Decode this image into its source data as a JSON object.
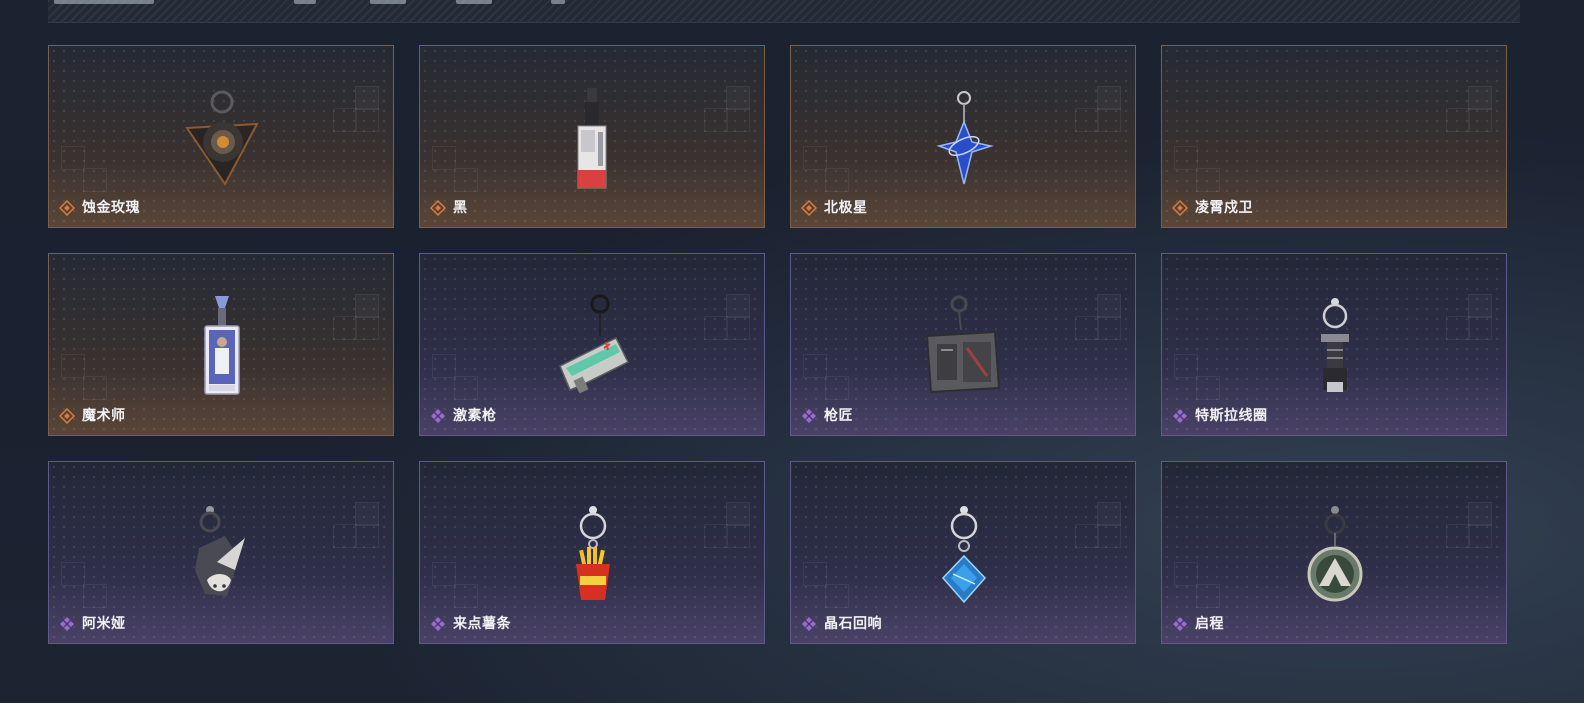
{
  "page": {
    "title": ""
  },
  "rarity_colors": {
    "gold": "#e07a3a",
    "purple": "#9a6ad6"
  },
  "cards": [
    {
      "name": "蚀金玫瑰",
      "rarity": "gold",
      "icon": "charm-corroded-rose-icon"
    },
    {
      "name": "黑",
      "rarity": "gold",
      "icon": "charm-black-tag-icon"
    },
    {
      "name": "北极星",
      "rarity": "gold",
      "icon": "charm-polaris-star-icon"
    },
    {
      "name": "凌霄戍卫",
      "rarity": "gold",
      "icon": ""
    },
    {
      "name": "魔术师",
      "rarity": "gold",
      "icon": "charm-magician-card-icon"
    },
    {
      "name": "激素枪",
      "rarity": "purple",
      "icon": "charm-stim-gun-icon"
    },
    {
      "name": "枪匠",
      "rarity": "purple",
      "icon": "charm-gunsmith-case-icon"
    },
    {
      "name": "特斯拉线圈",
      "rarity": "purple",
      "icon": "charm-tesla-coil-icon"
    },
    {
      "name": "阿米娅",
      "rarity": "purple",
      "icon": "charm-amiya-bunny-icon"
    },
    {
      "name": "来点薯条",
      "rarity": "purple",
      "icon": "charm-fries-icon"
    },
    {
      "name": "晶石回响",
      "rarity": "purple",
      "icon": "charm-crystal-echo-icon"
    },
    {
      "name": "启程",
      "rarity": "purple",
      "icon": "charm-departure-medal-icon"
    }
  ]
}
